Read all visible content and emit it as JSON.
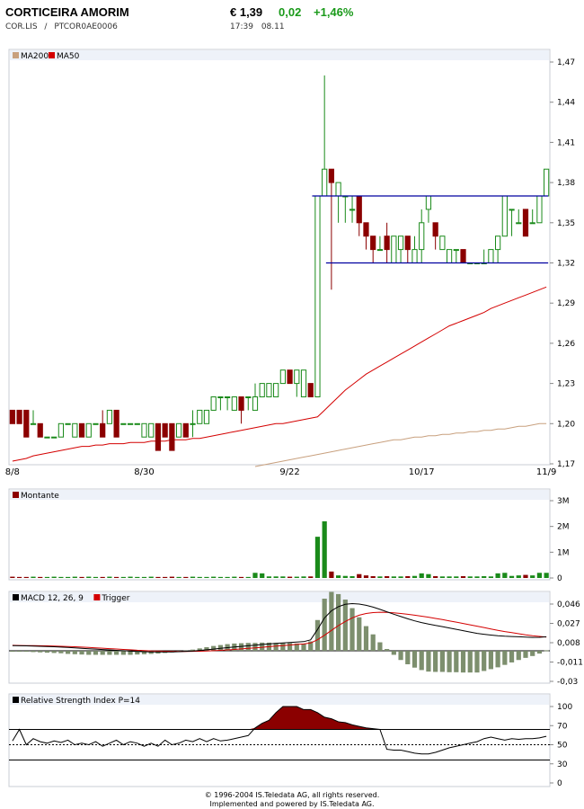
{
  "header": {
    "name": "CORTICEIRA AMORIM",
    "symbol": "COR.LIS",
    "separator": "/",
    "isin": "PTCOR0AE0006",
    "price": "€ 1,39",
    "change": "0,02",
    "change_pct": "+1,46%",
    "time": "17:39",
    "date": "08.11"
  },
  "colors": {
    "up": "#1a8a1a",
    "down": "#8b0000",
    "ma200": "#c8a07e",
    "ma50": "#d40000",
    "trendline": "#0000a0",
    "rsi_fill": "#8b0000",
    "macd_hist": "#7d8f6e",
    "panel_bg": "#eef2f9"
  },
  "chart_data": [
    {
      "type": "candlestick",
      "title": "",
      "legend": [
        "MA200",
        "MA50"
      ],
      "x_ticks": [
        "8/8",
        "8/30",
        "9/22",
        "10/17",
        "11/9"
      ],
      "y_ticks": [
        "1,47",
        "1,44",
        "1,41",
        "1,38",
        "1,35",
        "1,32",
        "1,29",
        "1,26",
        "1,23",
        "1,20",
        "1,17"
      ],
      "ylim": [
        1.17,
        1.47
      ],
      "candles": [
        [
          1.21,
          1.2,
          1.21,
          1.2
        ],
        [
          1.21,
          1.2,
          1.21,
          1.2
        ],
        [
          1.21,
          1.19,
          1.21,
          1.2
        ],
        [
          1.2,
          1.2,
          1.21,
          1.2
        ],
        [
          1.2,
          1.19,
          1.2,
          1.19
        ],
        [
          1.19,
          1.19,
          1.19,
          1.19
        ],
        [
          1.19,
          1.19,
          1.19,
          1.19
        ],
        [
          1.19,
          1.2,
          1.2,
          1.19
        ],
        [
          1.2,
          1.2,
          1.2,
          1.2
        ],
        [
          1.19,
          1.2,
          1.2,
          1.19
        ],
        [
          1.2,
          1.19,
          1.2,
          1.19
        ],
        [
          1.19,
          1.2,
          1.2,
          1.19
        ],
        [
          1.2,
          1.2,
          1.2,
          1.2
        ],
        [
          1.2,
          1.19,
          1.21,
          1.19
        ],
        [
          1.2,
          1.21,
          1.21,
          1.2
        ],
        [
          1.21,
          1.19,
          1.21,
          1.19
        ],
        [
          1.2,
          1.2,
          1.2,
          1.2
        ],
        [
          1.2,
          1.2,
          1.2,
          1.2
        ],
        [
          1.2,
          1.2,
          1.2,
          1.2
        ],
        [
          1.19,
          1.2,
          1.2,
          1.19
        ],
        [
          1.19,
          1.2,
          1.2,
          1.19
        ],
        [
          1.2,
          1.18,
          1.2,
          1.18
        ],
        [
          1.2,
          1.19,
          1.2,
          1.19
        ],
        [
          1.2,
          1.18,
          1.2,
          1.18
        ],
        [
          1.19,
          1.2,
          1.2,
          1.19
        ],
        [
          1.2,
          1.19,
          1.2,
          1.19
        ],
        [
          1.2,
          1.2,
          1.21,
          1.19
        ],
        [
          1.2,
          1.21,
          1.21,
          1.2
        ],
        [
          1.2,
          1.21,
          1.21,
          1.2
        ],
        [
          1.21,
          1.22,
          1.22,
          1.21
        ],
        [
          1.22,
          1.22,
          1.22,
          1.21
        ],
        [
          1.22,
          1.22,
          1.22,
          1.21
        ],
        [
          1.21,
          1.22,
          1.22,
          1.21
        ],
        [
          1.22,
          1.21,
          1.22,
          1.2
        ],
        [
          1.22,
          1.22,
          1.22,
          1.21
        ],
        [
          1.21,
          1.22,
          1.23,
          1.21
        ],
        [
          1.22,
          1.23,
          1.23,
          1.22
        ],
        [
          1.22,
          1.23,
          1.23,
          1.22
        ],
        [
          1.22,
          1.23,
          1.23,
          1.22
        ],
        [
          1.23,
          1.24,
          1.24,
          1.23
        ],
        [
          1.24,
          1.23,
          1.24,
          1.23
        ],
        [
          1.23,
          1.24,
          1.24,
          1.22
        ],
        [
          1.22,
          1.24,
          1.24,
          1.22
        ],
        [
          1.23,
          1.22,
          1.23,
          1.22
        ],
        [
          1.22,
          1.37,
          1.37,
          1.22
        ],
        [
          1.37,
          1.39,
          1.46,
          1.38
        ],
        [
          1.39,
          1.38,
          1.39,
          1.3
        ],
        [
          1.37,
          1.38,
          1.38,
          1.35
        ],
        [
          1.37,
          1.37,
          1.37,
          1.35
        ],
        [
          1.36,
          1.36,
          1.37,
          1.35
        ],
        [
          1.37,
          1.35,
          1.37,
          1.34
        ],
        [
          1.35,
          1.34,
          1.35,
          1.33
        ],
        [
          1.34,
          1.33,
          1.34,
          1.32
        ],
        [
          1.33,
          1.33,
          1.34,
          1.33
        ],
        [
          1.34,
          1.33,
          1.35,
          1.32
        ],
        [
          1.32,
          1.34,
          1.34,
          1.32
        ],
        [
          1.33,
          1.34,
          1.34,
          1.32
        ],
        [
          1.34,
          1.33,
          1.34,
          1.32
        ],
        [
          1.32,
          1.33,
          1.34,
          1.32
        ],
        [
          1.33,
          1.35,
          1.36,
          1.32
        ],
        [
          1.36,
          1.37,
          1.37,
          1.35
        ],
        [
          1.35,
          1.34,
          1.35,
          1.33
        ],
        [
          1.33,
          1.34,
          1.34,
          1.33
        ],
        [
          1.32,
          1.33,
          1.33,
          1.32
        ],
        [
          1.33,
          1.33,
          1.33,
          1.32
        ],
        [
          1.33,
          1.32,
          1.33,
          1.32
        ],
        [
          1.32,
          1.32,
          1.32,
          1.32
        ],
        [
          1.32,
          1.32,
          1.32,
          1.32
        ],
        [
          1.32,
          1.32,
          1.33,
          1.32
        ],
        [
          1.32,
          1.33,
          1.33,
          1.32
        ],
        [
          1.33,
          1.34,
          1.34,
          1.32
        ],
        [
          1.34,
          1.37,
          1.37,
          1.34
        ],
        [
          1.36,
          1.36,
          1.36,
          1.34
        ],
        [
          1.35,
          1.35,
          1.36,
          1.35
        ],
        [
          1.36,
          1.34,
          1.36,
          1.34
        ],
        [
          1.35,
          1.35,
          1.36,
          1.35
        ],
        [
          1.35,
          1.37,
          1.37,
          1.35
        ],
        [
          1.37,
          1.39,
          1.39,
          1.37
        ]
      ],
      "ma50": [
        1.172,
        1.173,
        1.174,
        1.176,
        1.177,
        1.178,
        1.179,
        1.18,
        1.181,
        1.182,
        1.183,
        1.183,
        1.184,
        1.184,
        1.185,
        1.185,
        1.185,
        1.186,
        1.186,
        1.186,
        1.187,
        1.187,
        1.187,
        1.188,
        1.188,
        1.188,
        1.189,
        1.189,
        1.19,
        1.191,
        1.192,
        1.193,
        1.194,
        1.195,
        1.196,
        1.197,
        1.198,
        1.199,
        1.2,
        1.2,
        1.201,
        1.202,
        1.203,
        1.204,
        1.205,
        1.21,
        1.215,
        1.22,
        1.225,
        1.229,
        1.233,
        1.237,
        1.24,
        1.243,
        1.246,
        1.249,
        1.252,
        1.255,
        1.258,
        1.261,
        1.264,
        1.267,
        1.27,
        1.273,
        1.275,
        1.277,
        1.279,
        1.281,
        1.283,
        1.286,
        1.288,
        1.29,
        1.292,
        1.294,
        1.296,
        1.298,
        1.3,
        1.302
      ],
      "ma200": [
        null,
        null,
        null,
        null,
        null,
        null,
        null,
        null,
        null,
        null,
        null,
        null,
        null,
        null,
        null,
        null,
        null,
        null,
        null,
        null,
        null,
        null,
        null,
        null,
        null,
        null,
        null,
        null,
        null,
        null,
        null,
        null,
        null,
        null,
        null,
        1.168,
        1.169,
        1.17,
        1.171,
        1.172,
        1.173,
        1.174,
        1.175,
        1.176,
        1.177,
        1.178,
        1.179,
        1.18,
        1.181,
        1.182,
        1.183,
        1.184,
        1.185,
        1.186,
        1.187,
        1.188,
        1.188,
        1.189,
        1.19,
        1.19,
        1.191,
        1.191,
        1.192,
        1.192,
        1.193,
        1.193,
        1.194,
        1.194,
        1.195,
        1.195,
        1.196,
        1.196,
        1.197,
        1.198,
        1.198,
        1.199,
        1.2,
        1.2
      ],
      "trendlines": [
        {
          "from_index": 44,
          "to_index": 77,
          "value": 1.37
        },
        {
          "from_index": 46,
          "to_index": 77,
          "value": 1.32
        }
      ]
    },
    {
      "type": "bar",
      "legend": [
        "Montante"
      ],
      "y_ticks": [
        "3M",
        "2M",
        "1M",
        "0"
      ],
      "ylim": [
        0,
        3000000
      ],
      "values": [
        50000,
        40000,
        40000,
        50000,
        40000,
        40000,
        50000,
        40000,
        40000,
        50000,
        40000,
        50000,
        40000,
        40000,
        50000,
        40000,
        40000,
        50000,
        40000,
        40000,
        50000,
        40000,
        40000,
        50000,
        40000,
        40000,
        50000,
        40000,
        40000,
        50000,
        40000,
        40000,
        50000,
        40000,
        40000,
        200000,
        180000,
        60000,
        60000,
        60000,
        50000,
        50000,
        60000,
        60000,
        1600000,
        2200000,
        250000,
        100000,
        80000,
        70000,
        150000,
        100000,
        70000,
        60000,
        70000,
        60000,
        60000,
        70000,
        80000,
        180000,
        150000,
        70000,
        60000,
        60000,
        60000,
        70000,
        60000,
        60000,
        70000,
        60000,
        180000,
        200000,
        80000,
        100000,
        120000,
        100000,
        200000,
        200000
      ]
    },
    {
      "type": "line",
      "legend": [
        "MACD 12, 26, 9",
        "Trigger"
      ],
      "y_ticks": [
        "0,046",
        "0,027",
        "0,008",
        "-0,011",
        "-0,03"
      ],
      "ylim": [
        -0.03,
        0.046
      ],
      "series": [
        {
          "name": "MACD 12, 26, 9",
          "values": [
            0.0051,
            0.005,
            0.0049,
            0.0047,
            0.0045,
            0.0043,
            0.004,
            0.0037,
            0.0033,
            0.0029,
            0.0025,
            0.0021,
            0.0017,
            0.0013,
            0.0009,
            0.0005,
            0.0001,
            -0.0003,
            -0.0006,
            -0.0008,
            -0.001,
            -0.0011,
            -0.0011,
            -0.001,
            -0.0008,
            -0.0005,
            -0.0001,
            0.0004,
            0.001,
            0.0017,
            0.0024,
            0.0031,
            0.0038,
            0.0044,
            0.005,
            0.0056,
            0.0062,
            0.0068,
            0.0073,
            0.0078,
            0.0083,
            0.0087,
            0.0091,
            0.0108,
            0.021,
            0.0324,
            0.0394,
            0.0434,
            0.0457,
            0.0464,
            0.046,
            0.0448,
            0.043,
            0.0408,
            0.0384,
            0.036,
            0.0337,
            0.0315,
            0.0295,
            0.0278,
            0.0263,
            0.025,
            0.0238,
            0.0225,
            0.0212,
            0.0198,
            0.0185,
            0.0172,
            0.0163,
            0.0155,
            0.0148,
            0.0144,
            0.0141,
            0.0138,
            0.0135,
            0.0132,
            0.0133,
            0.0138
          ]
        },
        {
          "name": "Trigger",
          "values": [
            0.0054,
            0.0053,
            0.0052,
            0.0051,
            0.005,
            0.0049,
            0.0047,
            0.0045,
            0.0043,
            0.004,
            0.0037,
            0.0034,
            0.003,
            0.0026,
            0.0022,
            0.0018,
            0.0014,
            0.001,
            0.0006,
            0.0003,
            0.0,
            -0.0002,
            -0.0004,
            -0.0005,
            -0.0006,
            -0.0006,
            -0.0005,
            -0.0004,
            -0.0002,
            0.0001,
            0.0005,
            0.0009,
            0.0014,
            0.0019,
            0.0024,
            0.003,
            0.0035,
            0.0041,
            0.0047,
            0.0052,
            0.0057,
            0.0063,
            0.0068,
            0.0077,
            0.0109,
            0.0153,
            0.0201,
            0.0248,
            0.0289,
            0.0324,
            0.035,
            0.0367,
            0.0376,
            0.038,
            0.0378,
            0.0373,
            0.0367,
            0.0359,
            0.035,
            0.0341,
            0.0331,
            0.0319,
            0.0307,
            0.0295,
            0.0282,
            0.0269,
            0.0256,
            0.0243,
            0.0229,
            0.0215,
            0.0202,
            0.019,
            0.0179,
            0.0168,
            0.0158,
            0.0149,
            0.0142,
            0.0136
          ]
        }
      ]
    },
    {
      "type": "line",
      "legend": [
        "Relative Strength Index P=14"
      ],
      "y_ticks": [
        "100",
        "70",
        "50",
        "30",
        "0"
      ],
      "ylim": [
        0,
        100
      ],
      "reference_lines": [
        70,
        50,
        30
      ],
      "values": [
        55,
        70,
        50,
        58,
        54,
        52,
        55,
        53,
        56,
        50,
        52,
        50,
        54,
        48,
        52,
        56,
        50,
        54,
        52,
        48,
        52,
        48,
        56,
        50,
        52,
        56,
        54,
        58,
        54,
        58,
        55,
        56,
        58,
        60,
        62,
        72,
        78,
        82,
        92,
        100,
        100,
        100,
        96,
        96,
        92,
        86,
        84,
        80,
        79,
        76,
        74,
        72,
        71,
        70,
        44,
        43,
        43,
        41,
        39,
        38,
        38,
        40,
        43,
        46,
        48,
        50,
        52,
        54,
        58,
        60,
        58,
        56,
        58,
        57,
        58,
        58,
        59,
        61
      ]
    }
  ]
}
